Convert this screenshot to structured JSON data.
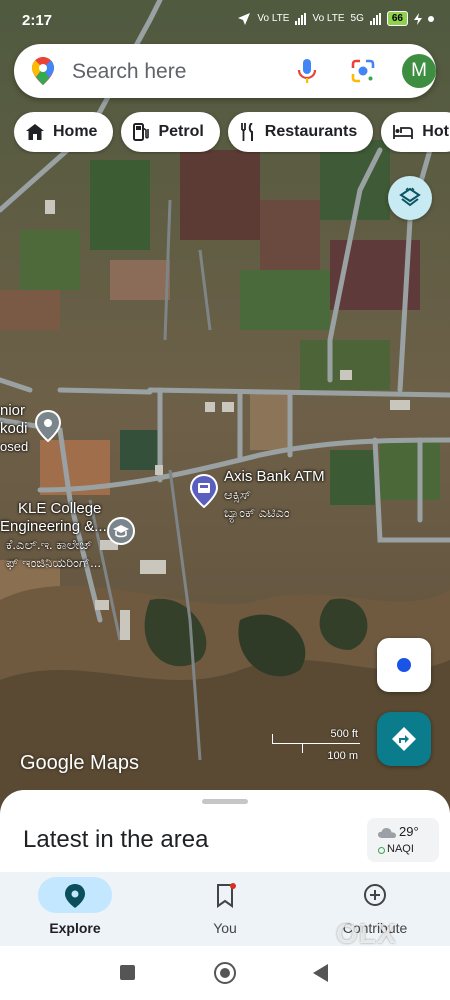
{
  "status_bar": {
    "time": "2:17",
    "net1": "Vo LTE",
    "net2": "Vo LTE",
    "net3": "5G",
    "battery": "66"
  },
  "search": {
    "placeholder": "Search here",
    "avatar_letter": "M"
  },
  "chips": [
    {
      "label": "Home",
      "icon": "home-icon"
    },
    {
      "label": "Petrol",
      "icon": "fuel-icon"
    },
    {
      "label": "Restaurants",
      "icon": "restaurant-icon"
    },
    {
      "label": "Hot",
      "icon": "hotel-icon"
    }
  ],
  "map": {
    "places": [
      {
        "name": "Axis Bank ATM",
        "sub": "ಆಕ್ಸಿಸ್",
        "sub2": "ಬ್ಯಾಂಕ್ ಎಟಿಎಂ"
      },
      {
        "name": "KLE College",
        "sub": "Engineering &...",
        "sub2": "ಕೆ.ಎಲ್.ಇ. ಕಾಲೇಜ್",
        "sub3": "ಫ್ ಇಂಜಿನಿಯರಿಂಗ್..."
      },
      {
        "name": "nior",
        "sub": "kodi",
        "sub2": "osed"
      }
    ],
    "scale_imperial": "500 ft",
    "scale_metric": "100 m",
    "logo": "Google Maps"
  },
  "sheet": {
    "heading": "Latest in the area",
    "weather_temp": "29°",
    "aqi_label": "NAQI"
  },
  "nav": [
    {
      "label": "Explore",
      "icon": "explore-pin-icon",
      "active": true
    },
    {
      "label": "You",
      "icon": "bookmark-icon",
      "active": false
    },
    {
      "label": "Contribute",
      "icon": "add-circle-icon",
      "active": false
    }
  ],
  "watermark": "OLX",
  "colors": {
    "accent": "#c2e7ff",
    "directions": "#0b7c8c",
    "location_dot": "#1a53e8",
    "avatar": "#3e8e41"
  }
}
